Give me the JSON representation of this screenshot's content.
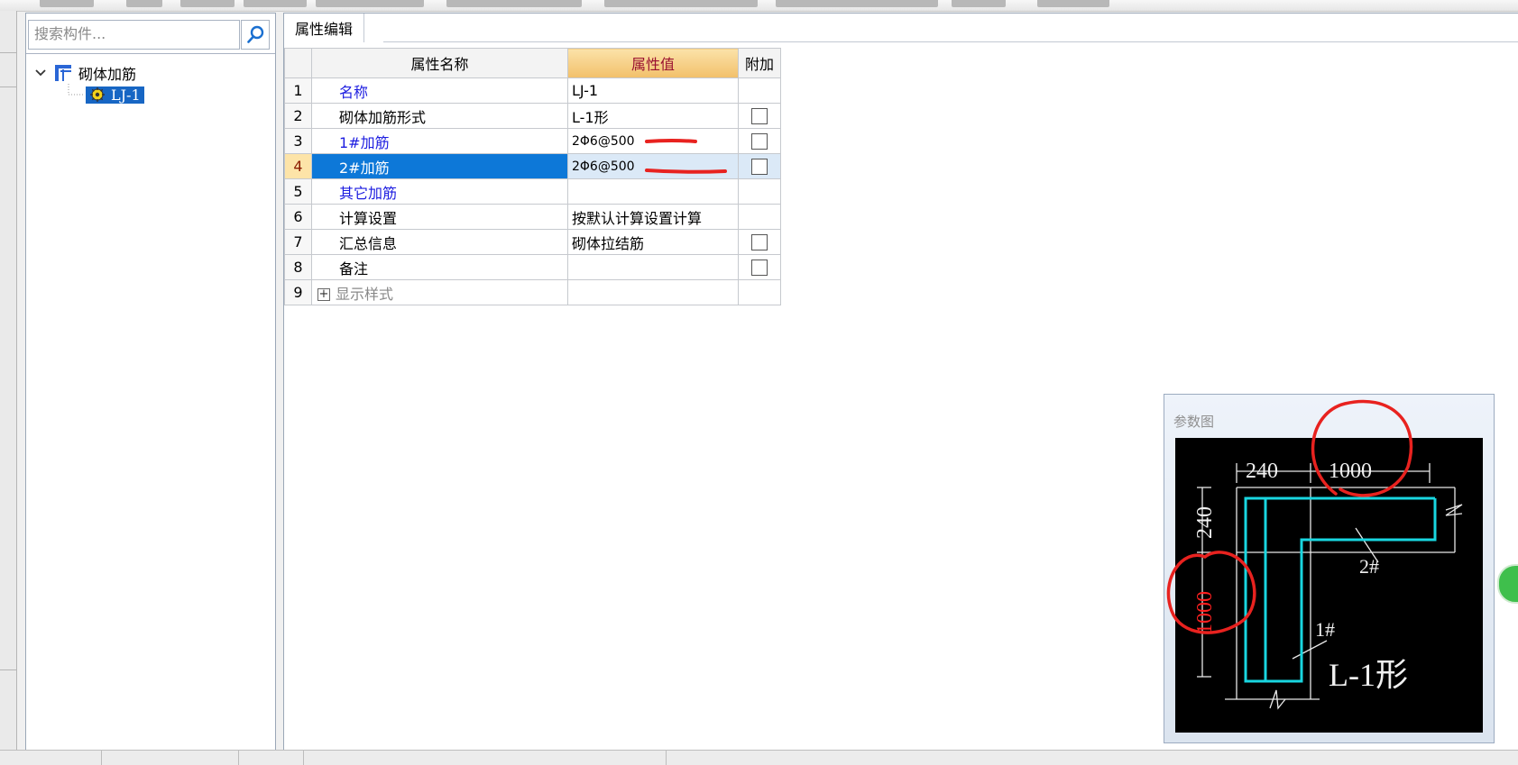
{
  "search": {
    "placeholder": "搜索构件..."
  },
  "tree": {
    "root_label": "砌体加筋",
    "child_label": "LJ-1"
  },
  "editor": {
    "tab_label": "属性编辑",
    "headers": {
      "name": "属性名称",
      "value": "属性值",
      "extra": "附加"
    },
    "rows": [
      {
        "num": "1",
        "name": "名称",
        "value": "LJ-1",
        "checkbox": false
      },
      {
        "num": "2",
        "name": "砌体加筋形式",
        "value": "L-1形",
        "checkbox": true
      },
      {
        "num": "3",
        "name": "1#加筋",
        "value": "2Φ6@500",
        "checkbox": true
      },
      {
        "num": "4",
        "name": "2#加筋",
        "value": "2Φ6@500",
        "checkbox": true
      },
      {
        "num": "5",
        "name": "其它加筋",
        "value": "",
        "checkbox": false
      },
      {
        "num": "6",
        "name": "计算设置",
        "value": "按默认计算设置计算",
        "checkbox": false
      },
      {
        "num": "7",
        "name": "汇总信息",
        "value": "砌体拉结筋",
        "checkbox": true
      },
      {
        "num": "8",
        "name": "备注",
        "value": "",
        "checkbox": true
      },
      {
        "num": "9",
        "name": "显示样式",
        "value": "",
        "checkbox": false
      }
    ]
  },
  "param_figure": {
    "title": "参数图",
    "dim_top_left": "240",
    "dim_top_right": "1000",
    "dim_left_top": "240",
    "dim_left_bottom": "1000",
    "label_2": "2#",
    "label_1": "1#",
    "shape_label": "L-1形"
  },
  "colors": {
    "selection_blue": "#0d78d8",
    "header_value_orange": "#f2c06a",
    "rebar_cyan": "#19d6e0",
    "annotation_red": "#e8221f"
  }
}
